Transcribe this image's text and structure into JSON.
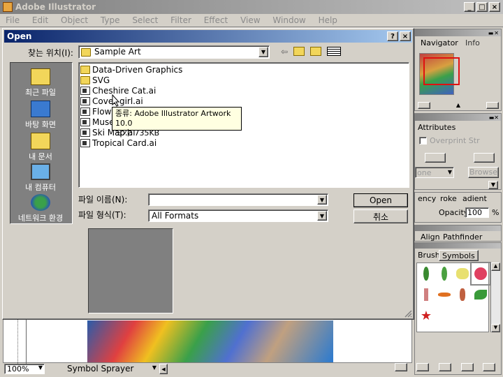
{
  "app": {
    "title": "Adobe Illustrator",
    "menu": [
      "File",
      "Edit",
      "Object",
      "Type",
      "Select",
      "Filter",
      "Effect",
      "View",
      "Window",
      "Help"
    ]
  },
  "dialog": {
    "title": "Open",
    "look_in_label": "찾는 위치(I):",
    "look_in_value": "Sample Art",
    "places": [
      "최근 파일",
      "바탕 화면",
      "내 문서",
      "내 컴퓨터",
      "네트워크 환경"
    ],
    "files": [
      {
        "name": "Data-Driven Graphics",
        "type": "folder"
      },
      {
        "name": "SVG",
        "type": "folder"
      },
      {
        "name": "Cheshire Cat.ai",
        "type": "file"
      },
      {
        "name": "Cover girl.ai",
        "type": "file"
      },
      {
        "name": "Flowe",
        "type": "file"
      },
      {
        "name": "Muse",
        "type": "file"
      },
      {
        "name": "Ski Map.ai",
        "type": "file"
      },
      {
        "name": "Tropical Card.ai",
        "type": "file"
      }
    ],
    "tooltip": {
      "line1": "종류: Adobe Illustrator Artwork 10.0",
      "line2": "크기: 735KB"
    },
    "filename_label": "파일 이름(N):",
    "filename_value": "",
    "filetype_label": "파일 형식(T):",
    "filetype_value": "All Formats",
    "open_button": "Open",
    "cancel_button": "취소",
    "help_button": "?",
    "close_button": "×"
  },
  "panels": {
    "navigator_tabs": [
      "Navigator",
      "Info"
    ],
    "attributes_tab": "Attributes",
    "overprint_label": "Overprint Str",
    "none_label": "one",
    "browse_label": "Browse",
    "transparency_tabs": [
      "ency",
      "roke",
      "adient"
    ],
    "opacity_label": "Opacity:",
    "opacity_value": "100",
    "opacity_unit": "%",
    "align_tabs": [
      "Align",
      "Pathfinder"
    ],
    "symbols_tabs": [
      "Brushe",
      "Symbols"
    ]
  },
  "statusbar": {
    "zoom": "100%",
    "tool": "Symbol Sprayer"
  },
  "colors": {
    "title_active": "#0a246a",
    "places_bg": "#808080",
    "tooltip_bg": "#ffffe1"
  }
}
